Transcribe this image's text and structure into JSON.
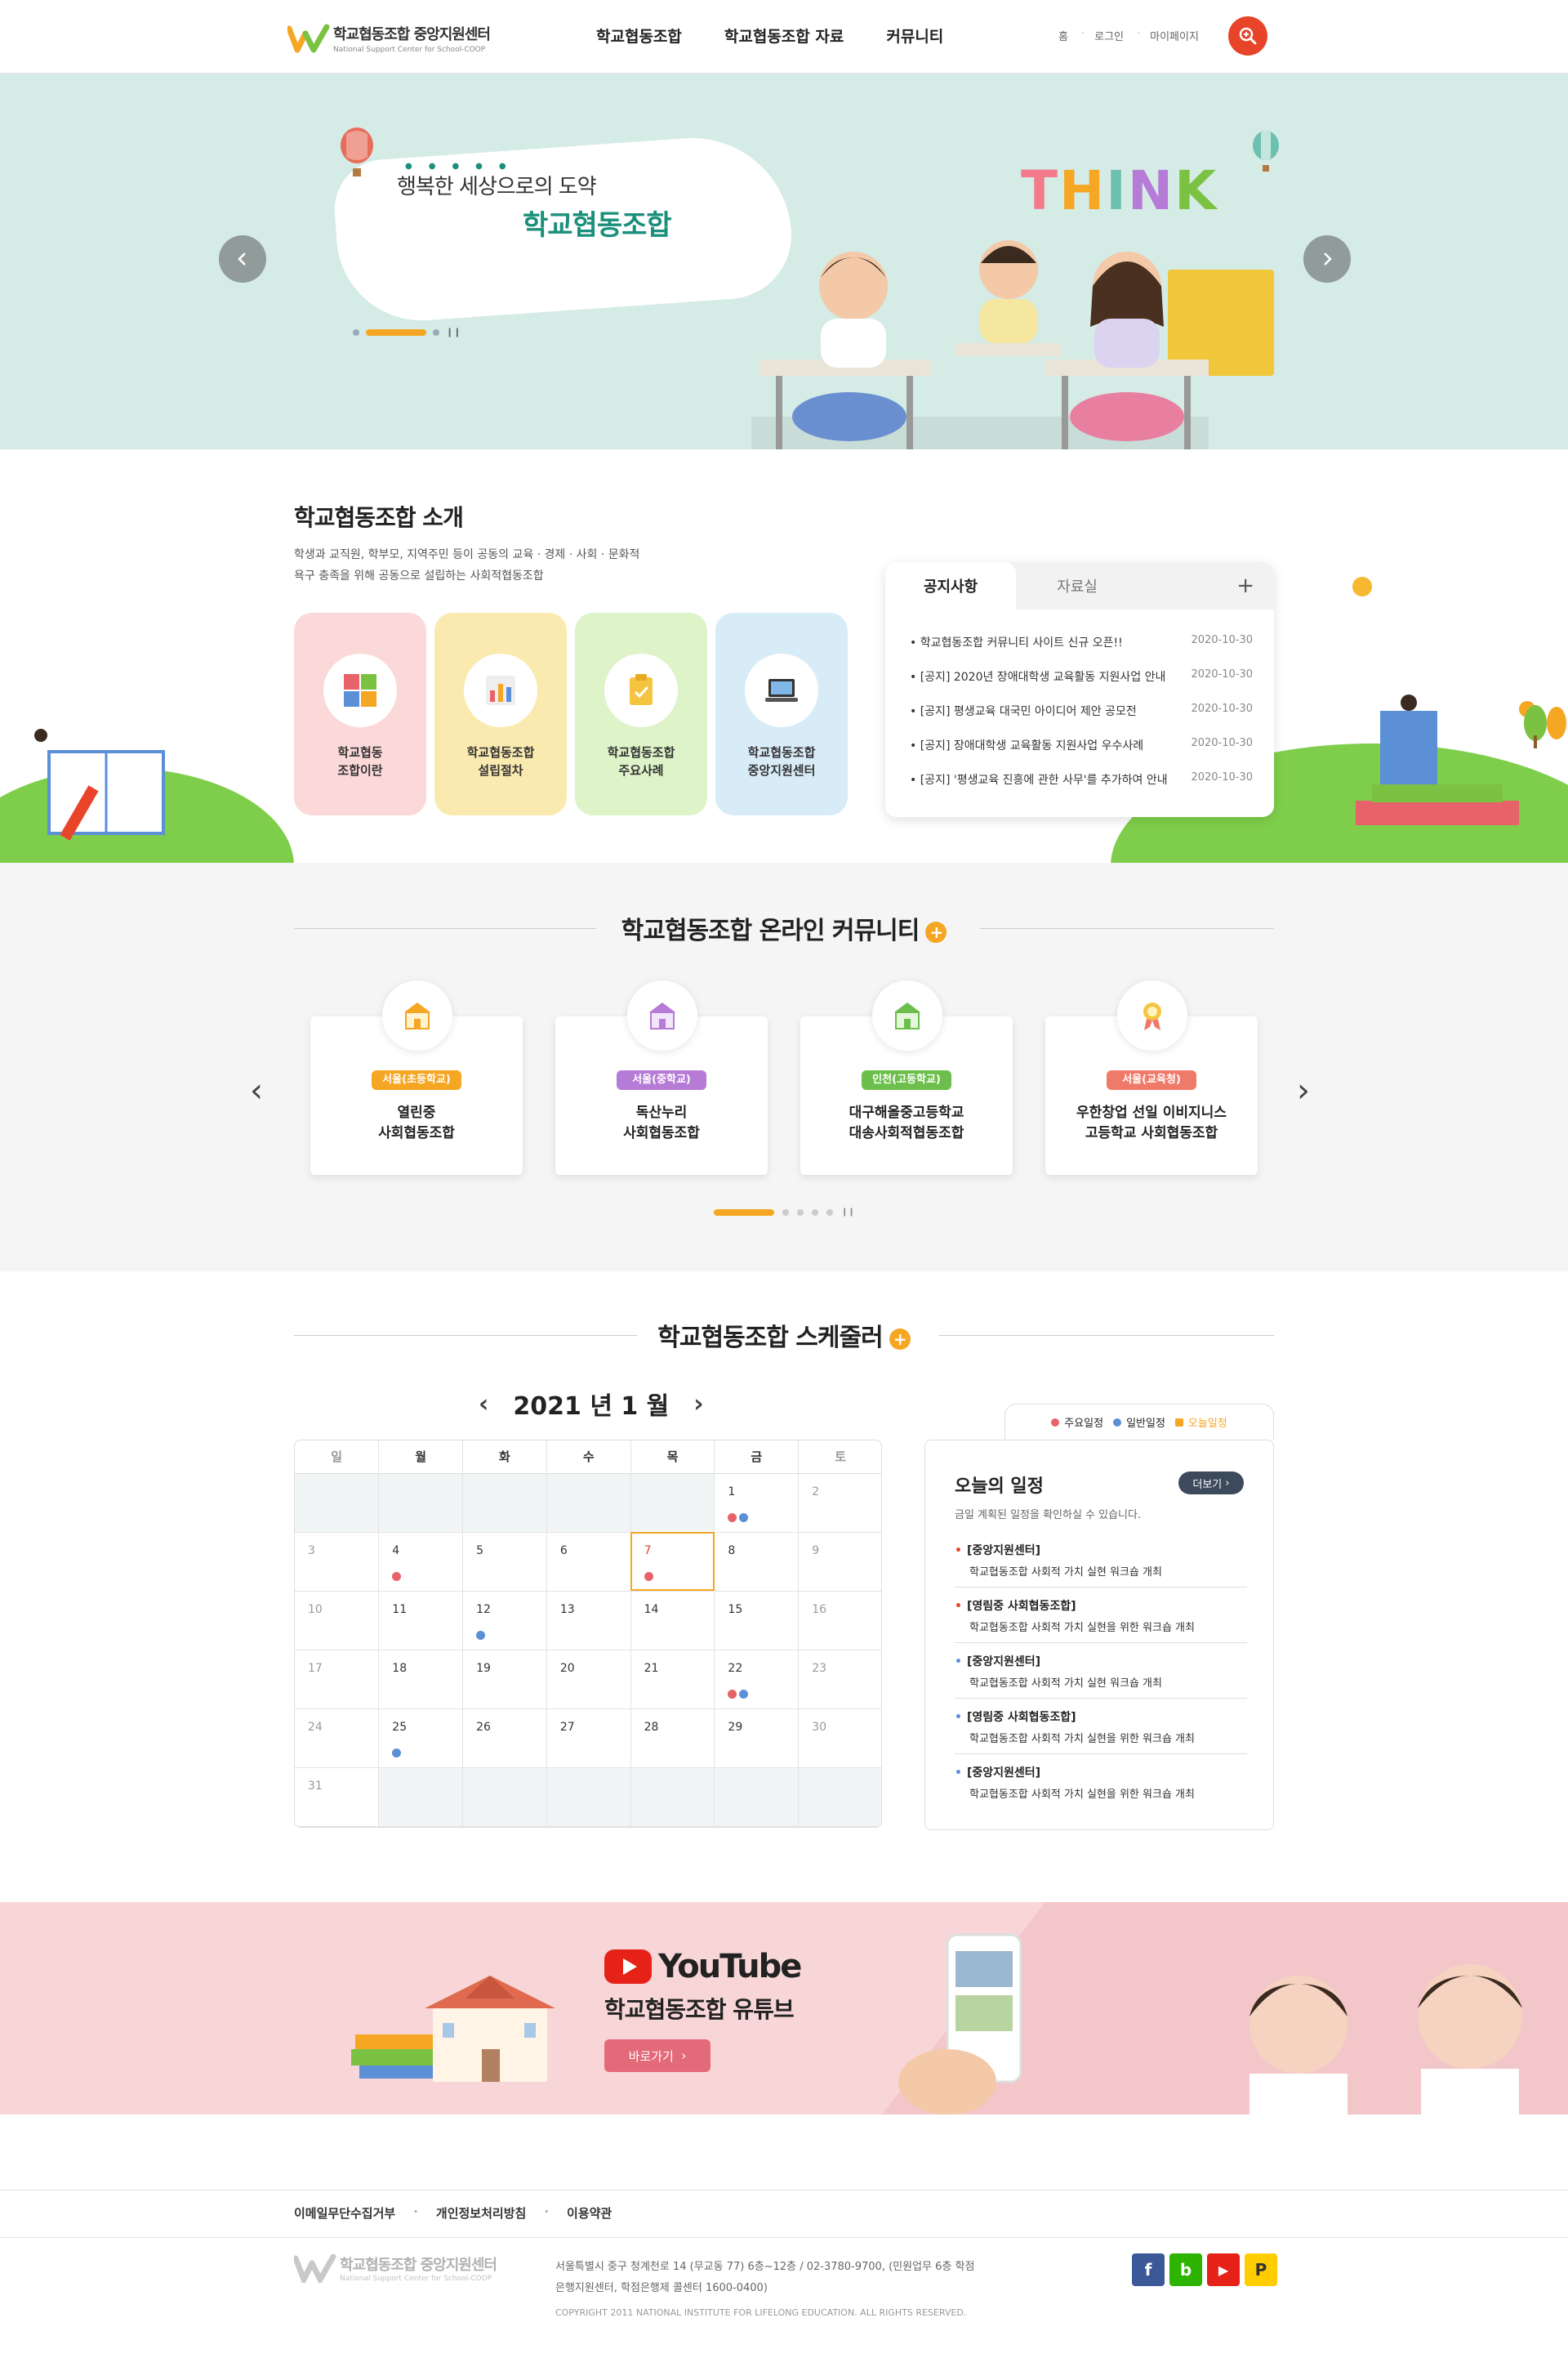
{
  "header": {
    "logo_title": "학교협동조합 중앙지원센터",
    "logo_sub": "National Support Center for School-COOP",
    "nav": [
      "학교협동조합",
      "학교협동조합 자료",
      "커뮤니티"
    ],
    "util": [
      "홈",
      "로그인",
      "마이페이지"
    ]
  },
  "hero": {
    "subtitle": "행복한 세상으로의 도약",
    "title": "학교협동조합",
    "think_text": "THINK"
  },
  "intro": {
    "title": "학교협동조합 소개",
    "desc_line1": "학생과 교직원, 학부모, 지역주민 등이 공동의 교육 · 경제 · 사회 · 문화적",
    "desc_line2": "욕구 충족을 위해 공동으로 설립하는 사회적협동조합",
    "cards": [
      {
        "line1": "학교협동",
        "line2": "조합이란",
        "color": "#fbd9d8"
      },
      {
        "line1": "학교협동조합",
        "line2": "설립절차",
        "color": "#fbeab0"
      },
      {
        "line1": "학교협동조합",
        "line2": "주요사례",
        "color": "#def3c8"
      },
      {
        "line1": "학교협동조합",
        "line2": "중앙지원센터",
        "color": "#d8ecf8"
      }
    ]
  },
  "notice": {
    "tab_active": "공지사항",
    "tab_inactive": "자료실",
    "items": [
      {
        "title": "학교협동조합 커뮤니티 사이트 신규 오픈!!",
        "date": "2020-10-30"
      },
      {
        "title": "[공지] 2020년 장애대학생 교육활동 지원사업 안내",
        "date": "2020-10-30"
      },
      {
        "title": "[공지] 평생교육 대국민 아이디어 제안 공모전",
        "date": "2020-10-30"
      },
      {
        "title": "[공지] 장애대학생 교육활동 지원사업 우수사례",
        "date": "2020-10-30"
      },
      {
        "title": "[공지] '평생교육 진흥에 관한 사무'를 추가하여 안내",
        "date": "2020-10-30"
      }
    ]
  },
  "community": {
    "title": "학교협동조합 온라인 커뮤니티",
    "cards": [
      {
        "badge": "서울(초등학교)",
        "badge_color": "#f5a623",
        "line1": "열린중",
        "line2": "사회협동조합"
      },
      {
        "badge": "서울(중학교)",
        "badge_color": "#b57bd6",
        "line1": "독산누리",
        "line2": "사회협동조합"
      },
      {
        "badge": "인천(고등학교)",
        "badge_color": "#6cbf4a",
        "line1": "대구해올중고등학교",
        "line2": "대송사회적협동조합"
      },
      {
        "badge": "서울(교육청)",
        "badge_color": "#f07a6a",
        "line1": "우한창업 선일 이비지니스",
        "line2": "고등학교 사회협동조합"
      }
    ]
  },
  "schedule": {
    "title": "학교협동조합 스케줄러",
    "month": "2021 년 1 월",
    "weekdays": [
      "일",
      "월",
      "화",
      "수",
      "목",
      "금",
      "토"
    ],
    "weeks": [
      [
        "",
        "",
        "",
        "",
        "",
        "1",
        "2"
      ],
      [
        "3",
        "4",
        "5",
        "6",
        "7",
        "8",
        "9"
      ],
      [
        "10",
        "11",
        "12",
        "13",
        "14",
        "15",
        "16"
      ],
      [
        "17",
        "18",
        "19",
        "20",
        "21",
        "22",
        "23"
      ],
      [
        "24",
        "25",
        "26",
        "27",
        "28",
        "29",
        "30"
      ],
      [
        "31",
        "",
        "",
        "",
        "",
        "",
        ""
      ]
    ],
    "legend": [
      "주요일정",
      "일반일정",
      "오늘일정"
    ],
    "legend_colors": {
      "major": "#e8626a",
      "normal": "#5b8fd6",
      "today": "#f5a623"
    },
    "today_title": "오늘의 일정",
    "more": "더보기",
    "today_desc": "금일 계획된 일정을 확인하실 수 있습니다.",
    "items": [
      {
        "org": "[중앙지원센터]",
        "desc": "학교협동조합 사회적 가치 실현 워크숍 개최"
      },
      {
        "org": "[영림중 사회협동조합]",
        "desc": "학교협동조합 사회적 가치 실현을 위한 워크숍 개최"
      },
      {
        "org": "[중앙지원센터]",
        "desc": "학교협동조합 사회적 가치 실현 워크숍 개최"
      },
      {
        "org": "[영림중 사회협동조합]",
        "desc": "학교협동조합 사회적 가치 실현을 위한 워크숍 개최"
      },
      {
        "org": "[중앙지원센터]",
        "desc": "학교협동조합 사회적 가치 실현을 위한 워크숍 개최"
      }
    ]
  },
  "youtube": {
    "brand": "YouTube",
    "title": "학교협동조합 유튜브",
    "button": "바로가기"
  },
  "footer": {
    "links": [
      "이메일무단수집거부",
      "개인정보처리방침",
      "이용약관"
    ],
    "logo_title": "학교협동조합 중앙지원센터",
    "logo_sub": "National Support Center for School-COOP",
    "addr1": "서울특별시 중구 청계천로 14 (무교동 77) 6층~12층 / 02-3780-9700, (민원업무 6층 학점",
    "addr2": "은행지원센터, 학점은행제 콜센터 1600-0400)",
    "copyright": "COPYRIGHT 2011 NATIONAL INSTITUTE FOR LIFELONG EDUCATION. ALL RIGHTS RESERVED.",
    "sns": [
      "f",
      "b",
      "▶",
      "P"
    ]
  }
}
